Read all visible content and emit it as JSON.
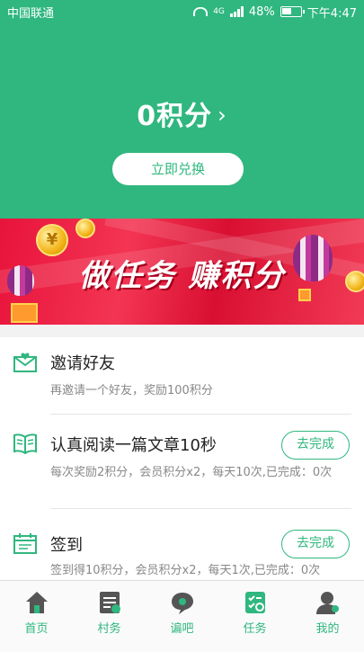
{
  "status_bar": {
    "carrier": "中国联通",
    "network": "4G",
    "battery": "48%",
    "time": "下午4:47"
  },
  "header": {
    "points": "0积分",
    "chevron": "›",
    "redeem_label": "立即兑换",
    "bg_color": "#2fb77f"
  },
  "banner": {
    "slogan": "做任务 赚积分",
    "coin_symbol": "¥"
  },
  "tasks": [
    {
      "icon": "invite-envelope-icon",
      "title": "邀请好友",
      "desc": "再邀请一个好友，奖励100积分",
      "action": ""
    },
    {
      "icon": "book-icon",
      "title": "认真阅读一篇文章10秒",
      "desc": "每次奖励2积分，会员积分x2，每天10次,已完成：0次",
      "action": "去完成"
    },
    {
      "icon": "calendar-icon",
      "title": "签到",
      "desc": "签到得10积分，会员积分x2，每天1次,已完成：0次",
      "action": "去完成"
    }
  ],
  "tabbar": [
    {
      "icon": "home-icon",
      "label": "首页",
      "active": false
    },
    {
      "icon": "affairs-icon",
      "label": "村务",
      "active": false
    },
    {
      "icon": "chat-icon",
      "label": "谝吧",
      "active": false
    },
    {
      "icon": "task-icon",
      "label": "任务",
      "active": true
    },
    {
      "icon": "profile-icon",
      "label": "我的",
      "active": false
    }
  ],
  "accent_color": "#2fb77f"
}
